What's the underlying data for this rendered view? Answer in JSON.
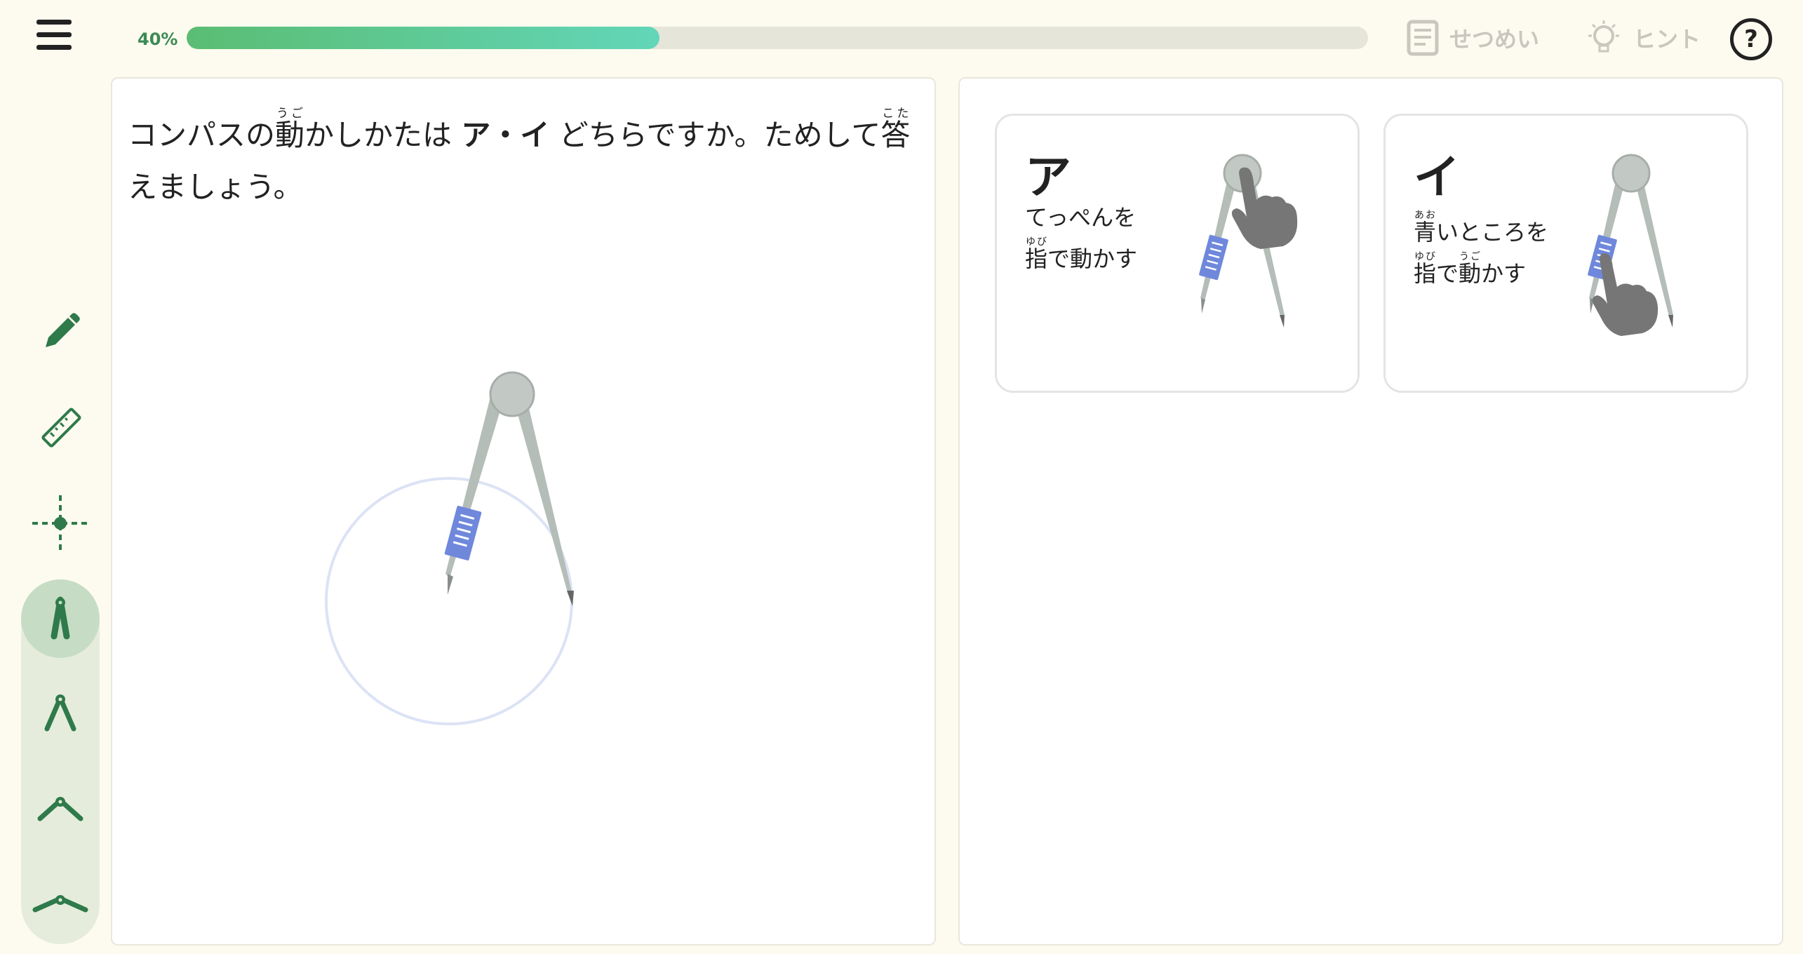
{
  "header": {
    "progress_label": "40%",
    "progress_value": 0.4,
    "explain_label": "せつめい",
    "hint_label": "ヒント",
    "help_label": "?"
  },
  "sidebar": {
    "tools": [
      {
        "icon": "pencil-icon"
      },
      {
        "icon": "ruler-icon"
      },
      {
        "icon": "crosshair-point-icon"
      },
      {
        "icon": "compass-narrow-icon",
        "active": true
      },
      {
        "icon": "compass-medium-icon"
      },
      {
        "icon": "compass-wide-icon"
      },
      {
        "icon": "compass-widest-icon"
      }
    ]
  },
  "question": {
    "part1": "コンパスの",
    "ugo_kanji": "動",
    "ugo_ruby": "うご",
    "part2": "かしかたは ",
    "options_text": "ア・イ",
    "part3": " どちらですか。ためして",
    "kotae_kanji": "答",
    "kotae_ruby": "こた",
    "part4": "えましょう。"
  },
  "options": [
    {
      "letter": "ア",
      "line1": "てっぺんを",
      "line2_kanji1": "指",
      "line2_ruby1": "ゆび",
      "line2_mid": "で",
      "line2_kanji2": "動",
      "line2_rest": "かす"
    },
    {
      "letter": "イ",
      "line1_kanji": "青",
      "line1_ruby": "あお",
      "line1_rest": "いところを",
      "line2_kanji1": "指",
      "line2_ruby1": "ゆび",
      "line2_mid": "で",
      "line2_kanji2": "動",
      "line2_ruby2": "うご",
      "line2_rest": "かす"
    }
  ],
  "colors": {
    "accent_green": "#2f7a4a",
    "progress_start": "#5bbd73",
    "progress_end": "#62d6b8",
    "compass_handle": "#6f88dc",
    "hand": "#767676"
  }
}
